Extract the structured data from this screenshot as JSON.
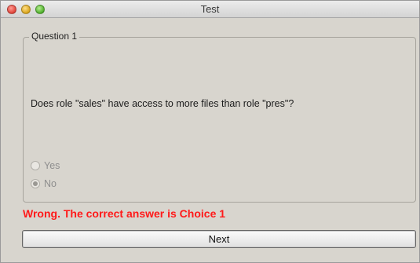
{
  "window": {
    "title": "Test"
  },
  "question_group": {
    "legend": "Question 1",
    "question_text": "Does role \"sales\" have access to more files than role \"pres\"?",
    "options": [
      {
        "label": "Yes",
        "selected": false
      },
      {
        "label": "No",
        "selected": true
      }
    ]
  },
  "feedback": {
    "text": "Wrong. The correct answer is Choice 1",
    "color": "#ff1a1a"
  },
  "actions": {
    "next_label": "Next"
  }
}
